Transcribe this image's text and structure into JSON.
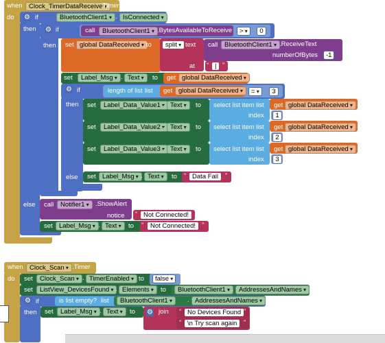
{
  "colors": {
    "event": "#c4a446",
    "control": "#4f6fc4",
    "setter": "#276c3e",
    "method_call": "#7e3e8d",
    "global_var": "#dc6a26",
    "text": "#b3335a",
    "list": "#5bace0",
    "logic": "#789bd4",
    "workspace": "#ffffff"
  },
  "timer_event": {
    "when": "when",
    "do": "do",
    "component": "Clock_TimerDataReceive",
    "event": ".Timer",
    "if": "if",
    "then": "then",
    "else": "else",
    "connected_component": "BluetoothClient1",
    "connected_property": "IsConnected",
    "gear_icon": "⚙",
    "inner_if": {
      "call": "call",
      "component": "BluetoothClient1",
      "method": ".BytesAvailableToReceive",
      "op": ">",
      "value": "0"
    },
    "set_global": {
      "set": "set",
      "var": "global DataReceived",
      "to": "to",
      "split": "split",
      "text": "text",
      "at": "at",
      "at_value": "|",
      "call": "call",
      "component": "BluetoothClient1",
      "method": ".ReceiveText",
      "param": "numberOfBytes",
      "param_value": "-1"
    },
    "set_label_msg": {
      "set": "set",
      "component": "Label_Msg",
      "prop": "Text",
      "to": "to",
      "get": "get",
      "var": "global DataReceived"
    },
    "length_if": {
      "if": "if",
      "length_of_list": "length of list",
      "list": "list",
      "get": "get",
      "var": "global DataReceived",
      "op": "=",
      "value": "3",
      "then": "then",
      "else": "else"
    },
    "value_setters": [
      {
        "set": "set",
        "component": "Label_Data_Value1",
        "prop": "Text",
        "to": "to",
        "select": "select list item",
        "list": "list",
        "get": "get",
        "var": "global DataReceived",
        "index_label": "index",
        "index": "1"
      },
      {
        "set": "set",
        "component": "Label_Data_Value2",
        "prop": "Text",
        "to": "to",
        "select": "select list item",
        "list": "list",
        "get": "get",
        "var": "global DataReceived",
        "index_label": "index",
        "index": "2"
      },
      {
        "set": "set",
        "component": "Label_Data_Value3",
        "prop": "Text",
        "to": "to",
        "select": "select list item",
        "list": "list",
        "get": "get",
        "var": "global DataReceived",
        "index_label": "index",
        "index": "3"
      }
    ],
    "data_fail": {
      "set": "set",
      "component": "Label_Msg",
      "prop": "Text",
      "to": "to",
      "text": "Data Fail"
    },
    "outer_else": {
      "call": "call",
      "component": "Notifier1",
      "method": ".ShowAlert",
      "notice": "notice",
      "notice_text": "Not Connected!",
      "set": "set",
      "set_component": "Label_Msg",
      "prop": "Text",
      "to": "to",
      "text": "Not Connected!"
    }
  },
  "scan_event": {
    "when": "when",
    "do": "do",
    "component": "Clock_Scan",
    "event": ".Timer",
    "set_timer": {
      "set": "set",
      "component": "Clock_Scan",
      "prop": "TimerEnabled",
      "to": "to",
      "value": "false"
    },
    "set_elements": {
      "set": "set",
      "component": "ListView_DevicesFound",
      "prop": "Elements",
      "to": "to",
      "src_component": "BluetoothClient1",
      "src_prop": "AddressesAndNames"
    },
    "empty_if": {
      "if": "if",
      "is_list_empty": "is list empty?",
      "list": "list",
      "component": "BluetoothClient1",
      "prop": "AddressesAndNames",
      "then": "then",
      "set": "set",
      "label": "Label_Msg",
      "label_prop": "Text",
      "to": "to",
      "join": "join",
      "text1": "No Devices Found",
      "text2": "\\n Try scan again"
    }
  }
}
